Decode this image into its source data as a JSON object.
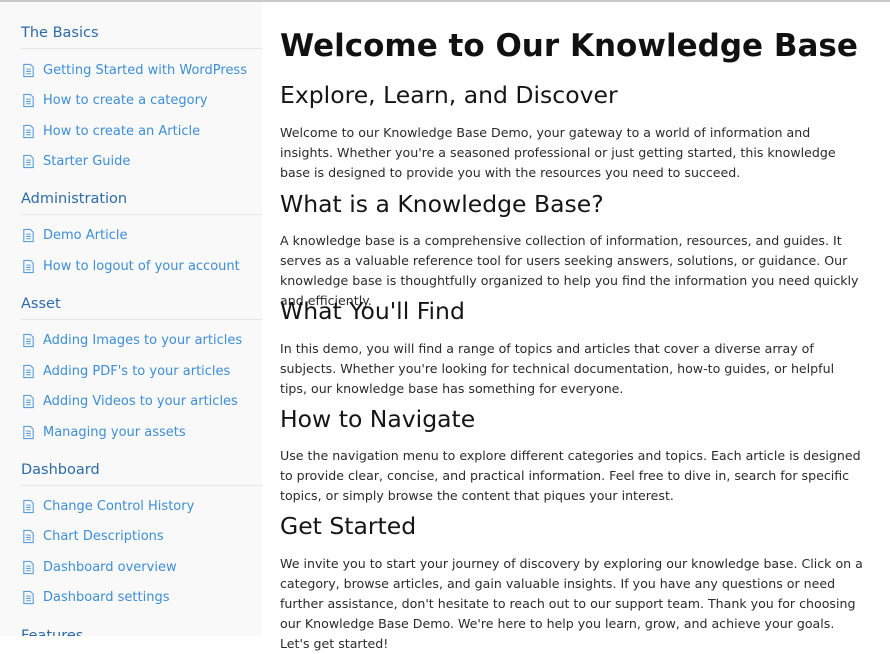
{
  "sidebar": {
    "categories": [
      {
        "title": "The Basics",
        "items": [
          "Getting Started with WordPress",
          "How to create a category",
          "How to create an Article",
          "Starter Guide"
        ]
      },
      {
        "title": "Administration",
        "items": [
          "Demo Article",
          "How to logout of your account"
        ]
      },
      {
        "title": "Asset",
        "items": [
          "Adding Images to your articles",
          "Adding PDF's to your articles",
          "Adding Videos to your articles",
          "Managing your assets"
        ]
      },
      {
        "title": "Dashboard",
        "items": [
          "Change Control History",
          "Chart Descriptions",
          "Dashboard overview",
          "Dashboard settings"
        ]
      },
      {
        "title": "Features",
        "items": []
      }
    ]
  },
  "main": {
    "title": "Welcome to Our Knowledge Base",
    "sections": [
      {
        "heading": "Explore, Learn, and Discover",
        "text": "Welcome to our Knowledge Base Demo, your gateway to a world of information and insights. Whether you're a seasoned professional or just getting started, this knowledge base is designed to provide you with the resources you need to succeed."
      },
      {
        "heading": "What is a Knowledge Base?",
        "text": "A knowledge base is a comprehensive collection of information, resources, and guides. It serves as a valuable reference tool for users seeking answers, solutions, or guidance. Our knowledge base is thoughtfully organized to help you find the information you need quickly and efficiently."
      },
      {
        "heading": "What You'll Find",
        "text": "In this demo, you will find a range of topics and articles that cover a diverse array of subjects. Whether you're looking for technical documentation, how-to guides, or helpful tips, our knowledge base has something for everyone."
      },
      {
        "heading": "How to Navigate",
        "text": "Use the navigation menu to explore different categories and topics. Each article is designed to provide clear, concise, and practical information. Feel free to dive in, search for specific topics, or simply browse the content that piques your interest."
      },
      {
        "heading": "Get Started",
        "text": "We invite you to start your journey of discovery by exploring our knowledge base. Click on a category, browse articles, and gain valuable insights. If you have any questions or need further assistance, don't hesitate to reach out to our support team. Thank you for choosing our Knowledge Base Demo. We're here to help you learn, grow, and achieve your goals. Let's get started!"
      }
    ]
  },
  "colors": {
    "category_title": "#2d6ba8",
    "article_link": "#3d8ed6",
    "icon": "#5b9fd9"
  },
  "icons": {
    "article": "document-icon"
  }
}
